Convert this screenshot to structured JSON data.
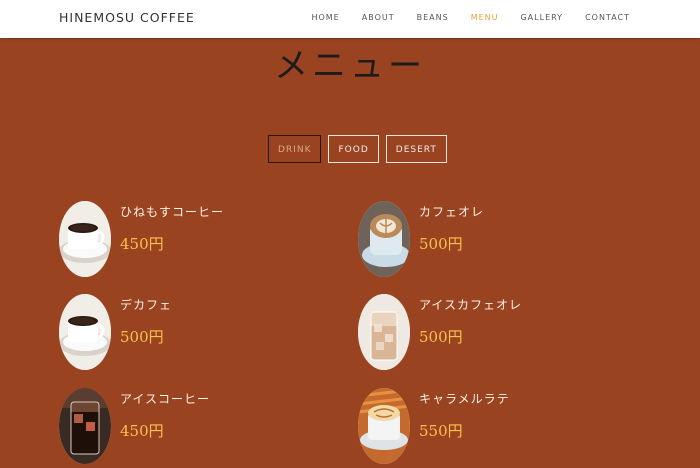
{
  "header": {
    "brand": "HINEMOSU COFFEE",
    "nav": [
      "HOME",
      "ABOUT",
      "BEANS",
      "MENU",
      "GALLERY",
      "CONTACT"
    ],
    "active_nav": "MENU",
    "active_color": "#e8a33c"
  },
  "page": {
    "title": "メニュー",
    "background": "#9a4320"
  },
  "tabs": [
    "DRINK",
    "FOOD",
    "DESERT"
  ],
  "menu": [
    {
      "name": "ひねもすコーヒー",
      "price": "450円",
      "image": "hot-coffee-cup"
    },
    {
      "name": "カフェオレ",
      "price": "500円",
      "image": "latte-art-cup"
    },
    {
      "name": "デカフェ",
      "price": "500円",
      "image": "hot-coffee-cup"
    },
    {
      "name": "アイスカフェオレ",
      "price": "500円",
      "image": "iced-latte-glass"
    },
    {
      "name": "アイスコーヒー",
      "price": "450円",
      "image": "iced-coffee-glass"
    },
    {
      "name": "キャラメルラテ",
      "price": "550円",
      "image": "caramel-latte-cup"
    }
  ],
  "price_color": "#ffc050"
}
